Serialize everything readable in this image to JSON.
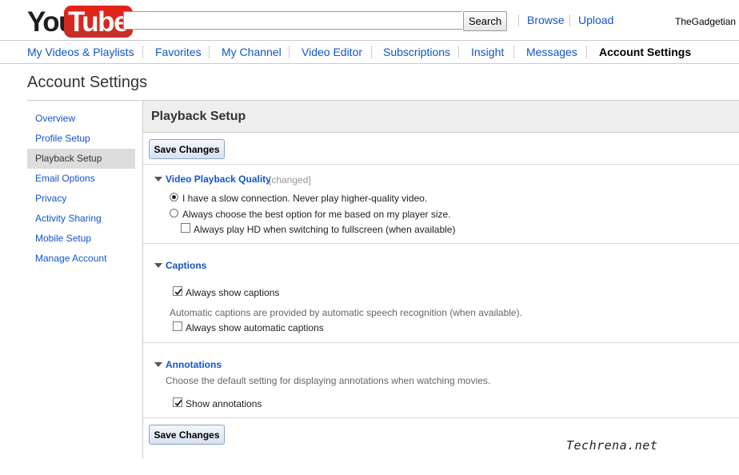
{
  "header": {
    "logo_you": "You",
    "logo_tube": "Tube",
    "search_value": "",
    "search_button": "Search",
    "browse": "Browse",
    "upload": "Upload",
    "username": "TheGadgetian"
  },
  "nav": {
    "items": [
      "My Videos & Playlists",
      "Favorites",
      "My Channel",
      "Video Editor",
      "Subscriptions",
      "Insight",
      "Messages",
      "Account Settings"
    ],
    "active": "Account Settings"
  },
  "page_title": "Account Settings",
  "sidebar": {
    "items": [
      "Overview",
      "Profile Setup",
      "Playback Setup",
      "Email Options",
      "Privacy",
      "Activity Sharing",
      "Mobile Setup",
      "Manage Account"
    ],
    "active": "Playback Setup"
  },
  "main": {
    "section_title": "Playback Setup",
    "save_button": "Save Changes",
    "quality": {
      "title": "Video Playback Quality",
      "changed": "[changed]",
      "option_slow": "I have a slow connection. Never play higher-quality video.",
      "option_best": "Always choose the best option for me based on my player size.",
      "option_hd": "Always play HD when switching to fullscreen (when available)",
      "selected": "slow",
      "hd_checked": false
    },
    "captions": {
      "title": "Captions",
      "always_show": "Always show captions",
      "always_show_checked": true,
      "auto_note": "Automatic captions are provided by automatic speech recognition (when available).",
      "auto_show": "Always show automatic captions",
      "auto_show_checked": false
    },
    "annotations": {
      "title": "Annotations",
      "description": "Choose the default setting for displaying annotations when watching movies.",
      "show": "Show annotations",
      "show_checked": true
    }
  },
  "watermark": "Techrena.net"
}
